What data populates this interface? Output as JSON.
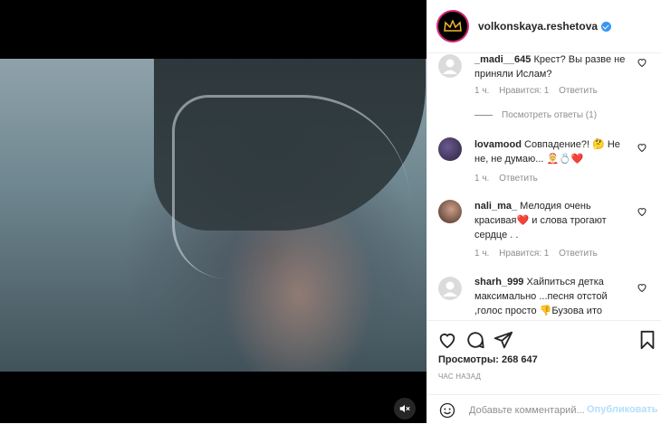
{
  "post": {
    "username": "volkonskaya.reshetova",
    "views_label": "Просмотры: 268 647",
    "time_label": "ЧАС НАЗАД"
  },
  "media": {
    "mute_icon": "speaker-muted-icon"
  },
  "comments": [
    {
      "user": "_madi__645",
      "text": "Крест? Вы разве не приняли Ислам?",
      "time": "1 ч.",
      "likes": "Нравится: 1",
      "reply": "Ответить",
      "avatar": "default-avatar",
      "view_replies": "Посмотреть ответы (1)"
    },
    {
      "user": "lovamood",
      "text": "Совпадение?! 🤔 Не не, не думаю... 🤶💍❤️",
      "time": "1 ч.",
      "reply": "Ответить",
      "avatar": "user-avatar"
    },
    {
      "user": "nali_ma_",
      "text": "Мелодия очень красивая❤️ и слова трогают сердце . .",
      "time": "1 ч.",
      "likes": "Нравится: 1",
      "reply": "Ответить",
      "avatar": "user-avatar"
    },
    {
      "user": "sharh_999",
      "text": "Хайпиться детка максимально ...песня отстой ,голос просто 👎Бузова ито",
      "avatar": "default-avatar"
    }
  ],
  "add_comment": {
    "placeholder": "Добавьте комментарий...",
    "publish_label": "Опубликовать"
  },
  "colors": {
    "accent": "#3897f0",
    "publish_disabled": "#b2dffc",
    "secondary_text": "#8e8e8e",
    "heart_emoji": "#ed4956"
  }
}
